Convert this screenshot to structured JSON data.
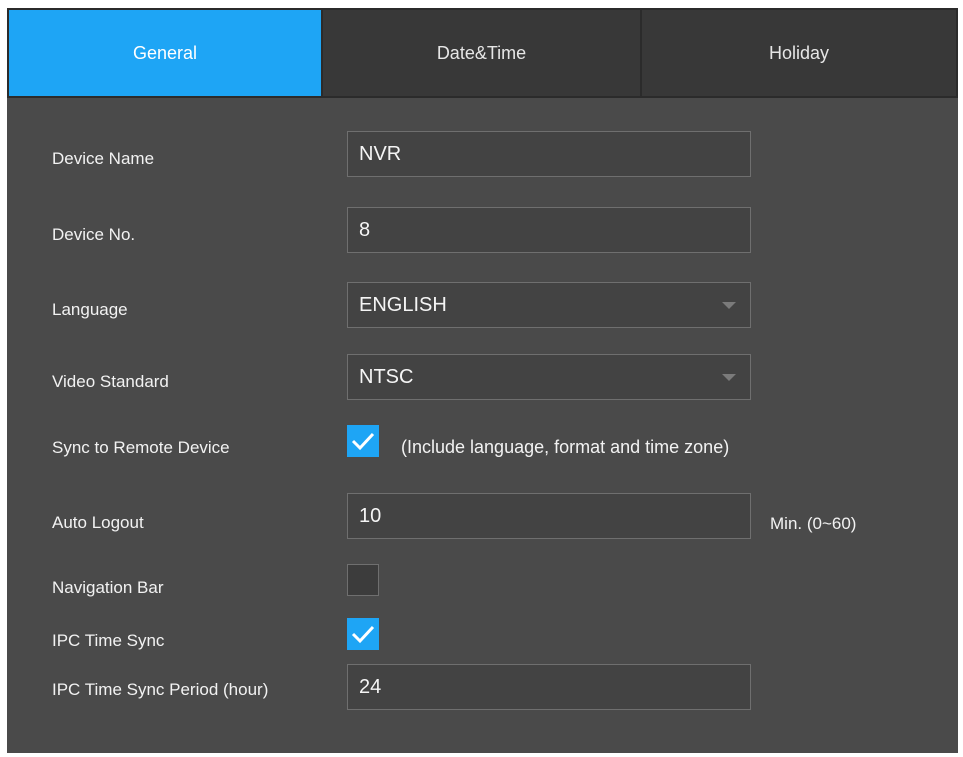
{
  "tabs": [
    {
      "label": "General",
      "active": true
    },
    {
      "label": "Date&Time",
      "active": false
    },
    {
      "label": "Holiday",
      "active": false
    }
  ],
  "form": {
    "device_name": {
      "label": "Device Name",
      "value": "NVR"
    },
    "device_no": {
      "label": "Device No.",
      "value": "8"
    },
    "language": {
      "label": "Language",
      "value": "ENGLISH"
    },
    "video_standard": {
      "label": "Video Standard",
      "value": "NTSC"
    },
    "sync_remote": {
      "label": "Sync to Remote Device",
      "checked": true,
      "note": "(Include language, format and time zone)"
    },
    "auto_logout": {
      "label": "Auto Logout",
      "value": "10",
      "unit": "Min. (0~60)"
    },
    "navigation_bar": {
      "label": "Navigation Bar",
      "checked": false
    },
    "ipc_time_sync": {
      "label": "IPC Time Sync",
      "checked": true
    },
    "ipc_sync_period": {
      "label": "IPC Time Sync Period (hour)",
      "value": "24"
    }
  },
  "colors": {
    "accent": "#1ea5f5",
    "panel": "#4a4a4a",
    "field": "#434343"
  },
  "icons": {
    "dropdown": "triangle-down-icon",
    "check": "checkmark-icon"
  }
}
